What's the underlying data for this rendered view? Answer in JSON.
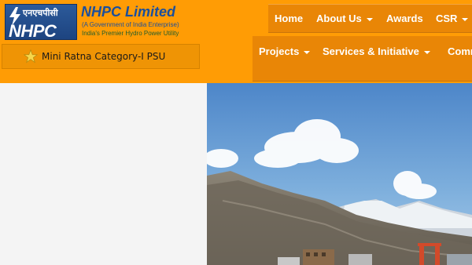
{
  "logo": {
    "hindi_text": "एनएचपीसी",
    "main_text": "NHPC"
  },
  "brand": {
    "title": "NHPC Limited",
    "subtitle": "(A Government of India Enterprise)",
    "tagline": "India's Premier Hydro Power Utility"
  },
  "badge": {
    "label": "Mini Ratna Category-I PSU",
    "icon": "star-icon"
  },
  "nav": {
    "row1": [
      {
        "label": "Home",
        "has_dropdown": false
      },
      {
        "label": "About Us",
        "has_dropdown": true
      },
      {
        "label": "Awards",
        "has_dropdown": false
      },
      {
        "label": "CSR",
        "has_dropdown": true
      }
    ],
    "row2": [
      {
        "label": "Projects",
        "has_dropdown": true
      },
      {
        "label": "Services & Initiative",
        "has_dropdown": true
      },
      {
        "label": "Comm",
        "has_dropdown": false
      }
    ]
  },
  "colors": {
    "header_orange": "#ff9c05",
    "nav_orange": "#e98606",
    "brand_blue": "#1b4f9c",
    "content_bg": "#f4f4f4"
  }
}
